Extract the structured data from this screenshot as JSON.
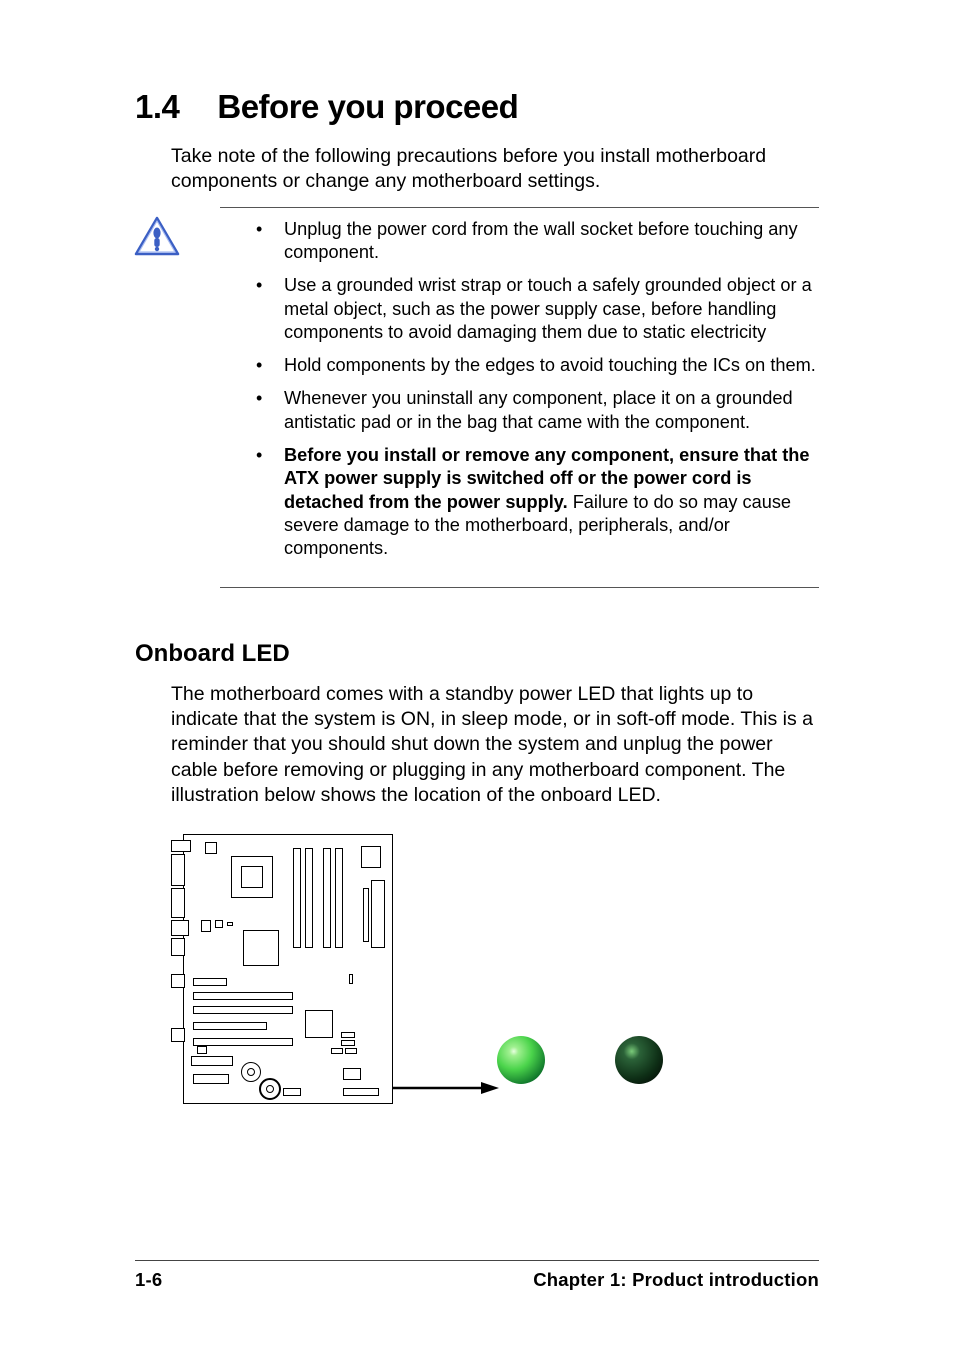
{
  "heading": {
    "number": "1.4",
    "title": "Before you proceed"
  },
  "intro": "Take note of the following precautions before you install motherboard components or change any motherboard settings.",
  "bullets": [
    {
      "text": "Unplug the power cord from the wall socket before touching any component."
    },
    {
      "text": "Use a grounded wrist strap or touch a safely grounded object or a metal object, such as the power supply case, before handling components to avoid damaging them due to static electricity"
    },
    {
      "text": "Hold components by the edges to avoid touching the ICs on them."
    },
    {
      "text": "Whenever you uninstall any component, place it on a grounded antistatic pad or in the bag that came with the component."
    },
    {
      "bold": "Before you install or remove any component, ensure that the ATX power supply is switched off or the power cord is detached from the power supply.",
      "rest": " Failure to do so may cause severe damage to the motherboard, peripherals, and/or components."
    }
  ],
  "subheading": "Onboard LED",
  "subintro": "The motherboard comes with a standby power LED that lights up to indicate that the system is ON, in sleep mode, or in soft-off mode. This is a reminder that you should shut down the system and unplug the power cable before removing or plugging in any motherboard component. The illustration below shows the location of the onboard LED.",
  "footer": {
    "page": "1-6",
    "chapter": "Chapter 1: Product introduction"
  },
  "icons": {
    "caution": "caution-icon",
    "motherboard": "motherboard-diagram",
    "arrow": "pointer-arrow",
    "led_on": "led-on-sphere",
    "led_off": "led-off-sphere"
  }
}
